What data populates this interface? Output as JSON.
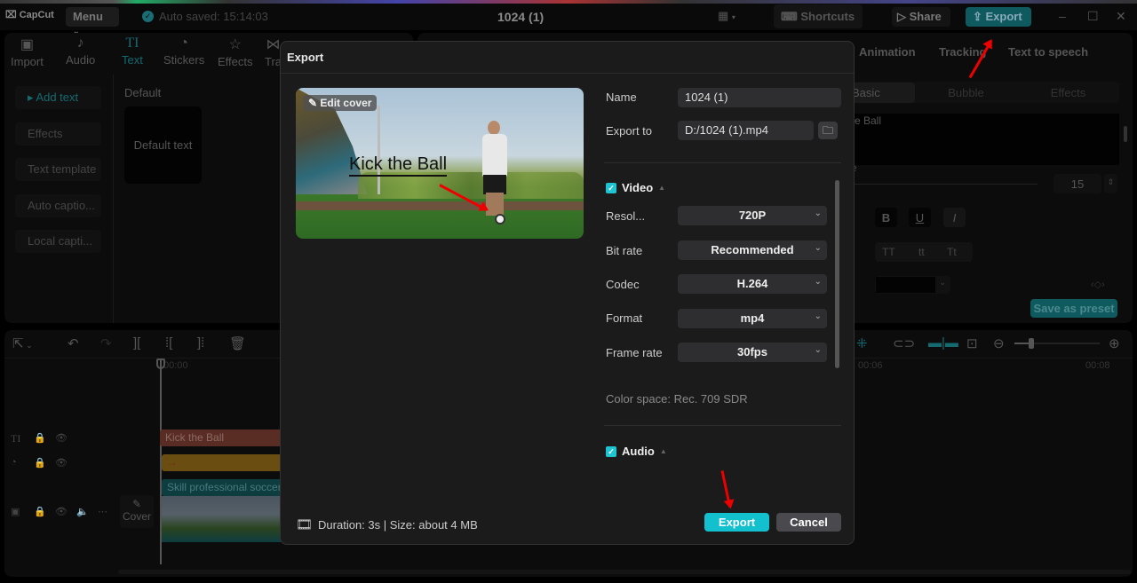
{
  "app": {
    "logo": "CapCut",
    "menu_label": "Menu",
    "autosave": "Auto saved: 15:14:03",
    "project_title": "1024 (1)",
    "shortcuts_label": "Shortcuts",
    "share_label": "Share",
    "export_label": "Export",
    "window_controls": {
      "minimize": "–",
      "maximize": "☐",
      "close": "✕"
    }
  },
  "toolbar": [
    {
      "label": "Import",
      "icon": "import-icon",
      "glyph": "▸"
    },
    {
      "label": "Audio",
      "icon": "audio-icon",
      "glyph": "♪"
    },
    {
      "label": "Text",
      "icon": "text-icon",
      "glyph": "TI",
      "active": true
    },
    {
      "label": "Stickers",
      "icon": "sticker-icon",
      "glyph": "◔"
    },
    {
      "label": "Effects",
      "icon": "effects-icon",
      "glyph": "☆"
    },
    {
      "label": "Tra",
      "icon": "transitions-icon",
      "glyph": "⋈"
    }
  ],
  "sidebar": {
    "items": [
      {
        "label": "▸ Add text",
        "active": true
      },
      {
        "label": "Effects"
      },
      {
        "label": "Text template"
      },
      {
        "label": "Auto captio..."
      },
      {
        "label": "Local capti..."
      }
    ]
  },
  "library": {
    "section": "Default",
    "card": "Default text"
  },
  "right_panel": {
    "tabs": [
      "Animation",
      "Tracking",
      "Text to speech"
    ],
    "subtabs": [
      "Basic",
      "Bubble",
      "Effects"
    ],
    "text_value": "e Ball",
    "partial_label": "e",
    "font_size": "15",
    "style_buttons": [
      "B",
      "U",
      "I"
    ],
    "case_buttons": [
      "TT",
      "tt",
      "Tt"
    ],
    "save_preset": "Save as preset"
  },
  "timeline": {
    "start_time": "00:00",
    "time_6": "00:06",
    "time_8": "00:08",
    "cover_label": "Cover",
    "clips": {
      "text": "Kick the Ball",
      "sticker": "→",
      "video": "Skill professional soccer"
    }
  },
  "dialog": {
    "title": "Export",
    "edit_cover": "Edit cover",
    "cover_text": "Kick the Ball",
    "name_label": "Name",
    "name_value": "1024 (1)",
    "export_to_label": "Export to",
    "export_to_value": "D:/1024 (1).mp4",
    "video_section": "Video",
    "video_checked": true,
    "settings": [
      {
        "label": "Resol...",
        "value": "720P"
      },
      {
        "label": "Bit rate",
        "value": "Recommended"
      },
      {
        "label": "Codec",
        "value": "H.264"
      },
      {
        "label": "Format",
        "value": "mp4"
      },
      {
        "label": "Frame rate",
        "value": "30fps"
      }
    ],
    "color_space": "Color space: Rec. 709 SDR",
    "audio_section": "Audio",
    "audio_checked": true,
    "footer_info": "Duration: 3s | Size: about 4 MB",
    "export_button": "Export",
    "cancel_button": "Cancel"
  },
  "colors": {
    "accent": "#13c0cd",
    "accent_dim": "#0f5a5e",
    "dialog_bg": "#1b1b1c",
    "annotation_arrow": "#ee0000"
  }
}
